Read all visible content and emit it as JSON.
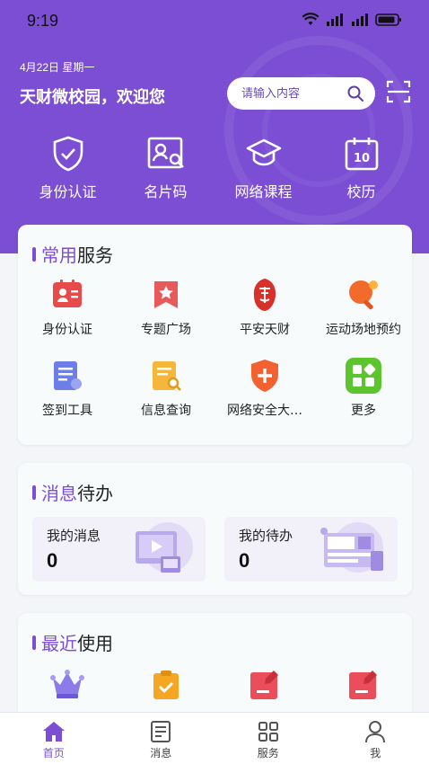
{
  "status_bar": {
    "time": "9:19"
  },
  "header": {
    "date": "4月22日 星期一",
    "welcome": "天财微校园，欢迎您",
    "search_placeholder": "请输入内容"
  },
  "quick_actions": [
    {
      "label": "身份认证",
      "icon": "shield-check-icon"
    },
    {
      "label": "名片码",
      "icon": "card-search-icon"
    },
    {
      "label": "网络课程",
      "icon": "graduation-cap-icon"
    },
    {
      "label": "校历",
      "icon": "calendar-icon"
    }
  ],
  "common_services": {
    "title_accent": "常用",
    "title_rest": "服务",
    "items": [
      {
        "label": "身份认证",
        "icon": "id-card-icon"
      },
      {
        "label": "专题广场",
        "icon": "star-bookmark-icon"
      },
      {
        "label": "平安天财",
        "icon": "seal-icon"
      },
      {
        "label": "运动场地预约",
        "icon": "ping-pong-icon"
      },
      {
        "label": "签到工具",
        "icon": "sign-in-doc-icon"
      },
      {
        "label": "信息查询",
        "icon": "doc-search-icon"
      },
      {
        "label": "网络安全大…",
        "icon": "shield-plus-icon"
      },
      {
        "label": "更多",
        "icon": "grid-more-icon"
      }
    ]
  },
  "messages": {
    "title_accent": "消息",
    "title_rest": "待办",
    "my_messages": {
      "label": "我的消息",
      "count": "0"
    },
    "my_todos": {
      "label": "我的待办",
      "count": "0"
    }
  },
  "recent": {
    "title_accent": "最近",
    "title_rest": "使用"
  },
  "tabbar": [
    {
      "label": "首页",
      "icon": "home-icon",
      "active": true
    },
    {
      "label": "消息",
      "icon": "message-doc-icon",
      "active": false
    },
    {
      "label": "服务",
      "icon": "apps-grid-icon",
      "active": false
    },
    {
      "label": "我",
      "icon": "user-icon",
      "active": false
    }
  ],
  "colors": {
    "brand": "#7b4ed4",
    "background": "#f4f5f9",
    "card": "#f7fbfc"
  }
}
